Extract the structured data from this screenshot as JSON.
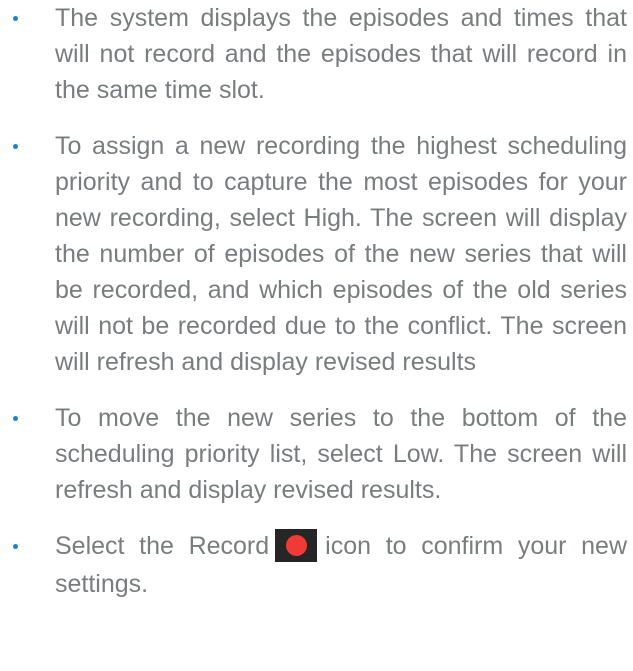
{
  "bullets": [
    {
      "text": "The system displays the episodes and times that will not record and the episodes that will record in the same time slot."
    },
    {
      "text": "To assign a new recording the highest scheduling priority and to capture the most episodes for your new recording, select High. The screen will display the number of episodes of the new series that will be recorded, and which episodes of the old series will not be recorded due to the conflict. The screen will refresh and display revised results"
    },
    {
      "text": "To move the new series to the bottom of the scheduling priority list, select Low. The screen will refresh and display revised results."
    },
    {
      "text_before_icon": "Select the Record",
      "icon": "record-icon",
      "text_after_icon": "icon to confirm your new settings."
    }
  ],
  "colors": {
    "text": "#7a7d80",
    "bullet": "#1f84c6",
    "record_icon_background": "#262626",
    "record_icon_dot": "#f03a38"
  }
}
